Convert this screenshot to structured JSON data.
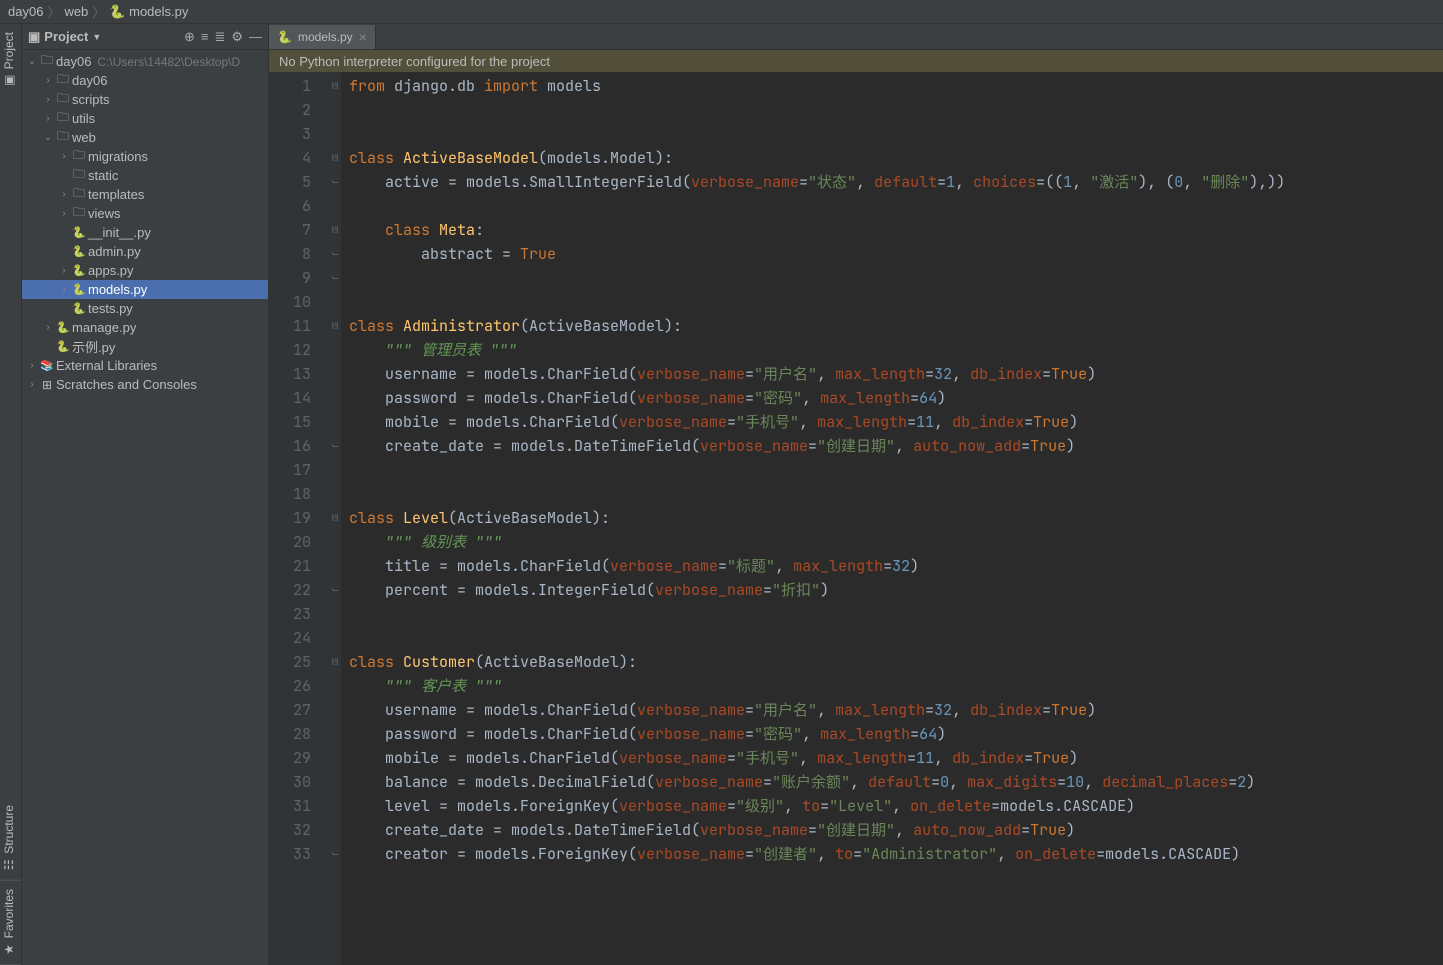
{
  "breadcrumb": [
    "day06",
    "web",
    "models.py"
  ],
  "project_label": "Project",
  "toolbar_icons": [
    "target-icon",
    "expand-icon",
    "collapse-icon",
    "gear-icon",
    "hide-icon"
  ],
  "tree": [
    {
      "depth": 0,
      "arrow": "v",
      "icon": "folder",
      "label": "day06",
      "path": "C:\\Users\\14482\\Desktop\\D",
      "selected": false
    },
    {
      "depth": 1,
      "arrow": ">",
      "icon": "pkg",
      "label": "day06"
    },
    {
      "depth": 1,
      "arrow": ">",
      "icon": "folder",
      "label": "scripts"
    },
    {
      "depth": 1,
      "arrow": ">",
      "icon": "folder",
      "label": "utils"
    },
    {
      "depth": 1,
      "arrow": "v",
      "icon": "pkg",
      "label": "web"
    },
    {
      "depth": 2,
      "arrow": ">",
      "icon": "pkg",
      "label": "migrations"
    },
    {
      "depth": 2,
      "arrow": "",
      "icon": "folder",
      "label": "static"
    },
    {
      "depth": 2,
      "arrow": ">",
      "icon": "folder",
      "label": "templates"
    },
    {
      "depth": 2,
      "arrow": ">",
      "icon": "pkg",
      "label": "views"
    },
    {
      "depth": 2,
      "arrow": "",
      "icon": "py",
      "label": "__init__.py"
    },
    {
      "depth": 2,
      "arrow": "",
      "icon": "py",
      "label": "admin.py"
    },
    {
      "depth": 2,
      "arrow": ">",
      "icon": "py",
      "label": "apps.py"
    },
    {
      "depth": 2,
      "arrow": ">",
      "icon": "py",
      "label": "models.py",
      "selected": true
    },
    {
      "depth": 2,
      "arrow": "",
      "icon": "py",
      "label": "tests.py"
    },
    {
      "depth": 1,
      "arrow": ">",
      "icon": "py",
      "label": "manage.py"
    },
    {
      "depth": 1,
      "arrow": "",
      "icon": "py",
      "label": "示例.py"
    },
    {
      "depth": 0,
      "arrow": ">",
      "icon": "lib",
      "label": "External Libraries"
    },
    {
      "depth": 0,
      "arrow": ">",
      "icon": "scratch",
      "label": "Scratches and Consoles"
    }
  ],
  "open_tab": "models.py",
  "warning": "No Python interpreter configured for the project",
  "sidebar_tabs": {
    "project": "Project",
    "structure": "Structure",
    "favorites": "Favorites"
  },
  "gutter": {
    "max_line": 33,
    "override_line": 4
  },
  "code_lines": [
    {
      "tokens": [
        [
          "kw",
          "from"
        ],
        [
          "",
          " django.db "
        ],
        [
          "kw",
          "import"
        ],
        [
          "",
          " models"
        ]
      ]
    },
    {
      "tokens": []
    },
    {
      "tokens": []
    },
    {
      "tokens": [
        [
          "kw",
          "class"
        ],
        [
          "",
          " "
        ],
        [
          "fn",
          "ActiveBaseModel"
        ],
        [
          "",
          "(models.Model):"
        ]
      ]
    },
    {
      "tokens": [
        [
          "",
          "    active = models.SmallIntegerField("
        ],
        [
          "param",
          "verbose_name"
        ],
        [
          "",
          "="
        ],
        [
          "str",
          "\"状态\""
        ],
        [
          "",
          ", "
        ],
        [
          "param",
          "default"
        ],
        [
          "",
          "="
        ],
        [
          "num",
          "1"
        ],
        [
          "",
          ", "
        ],
        [
          "param",
          "choices"
        ],
        [
          "",
          "=(("
        ],
        [
          "num",
          "1"
        ],
        [
          "",
          ", "
        ],
        [
          "str",
          "\"激活\""
        ],
        [
          "",
          "), ("
        ],
        [
          "num",
          "0"
        ],
        [
          "",
          ", "
        ],
        [
          "str",
          "\"删除\""
        ],
        [
          "",
          "),))"
        ]
      ]
    },
    {
      "tokens": []
    },
    {
      "tokens": [
        [
          "",
          "    "
        ],
        [
          "kw",
          "class"
        ],
        [
          "",
          " "
        ],
        [
          "fn",
          "Meta"
        ],
        [
          "",
          ":"
        ]
      ]
    },
    {
      "tokens": [
        [
          "",
          "        abstract = "
        ],
        [
          "kw",
          "True"
        ]
      ]
    },
    {
      "tokens": []
    },
    {
      "tokens": []
    },
    {
      "tokens": [
        [
          "kw",
          "class"
        ],
        [
          "",
          " "
        ],
        [
          "fn",
          "Administrator"
        ],
        [
          "",
          "(ActiveBaseModel):"
        ]
      ]
    },
    {
      "tokens": [
        [
          "doc",
          "    \"\"\" 管理员表 \"\"\""
        ]
      ]
    },
    {
      "tokens": [
        [
          "",
          "    username = models.CharField("
        ],
        [
          "param",
          "verbose_name"
        ],
        [
          "",
          "="
        ],
        [
          "str",
          "\"用户名\""
        ],
        [
          "",
          ", "
        ],
        [
          "param",
          "max_length"
        ],
        [
          "",
          "="
        ],
        [
          "num",
          "32"
        ],
        [
          "",
          ", "
        ],
        [
          "param",
          "db_index"
        ],
        [
          "",
          "="
        ],
        [
          "kw",
          "True"
        ],
        [
          "",
          ")"
        ]
      ]
    },
    {
      "tokens": [
        [
          "",
          "    password = models.CharField("
        ],
        [
          "param",
          "verbose_name"
        ],
        [
          "",
          "="
        ],
        [
          "str",
          "\"密码\""
        ],
        [
          "",
          ", "
        ],
        [
          "param",
          "max_length"
        ],
        [
          "",
          "="
        ],
        [
          "num",
          "64"
        ],
        [
          "",
          ")"
        ]
      ]
    },
    {
      "tokens": [
        [
          "",
          "    mobile = models.CharField("
        ],
        [
          "param",
          "verbose_name"
        ],
        [
          "",
          "="
        ],
        [
          "str",
          "\"手机号\""
        ],
        [
          "",
          ", "
        ],
        [
          "param",
          "max_length"
        ],
        [
          "",
          "="
        ],
        [
          "num",
          "11"
        ],
        [
          "",
          ", "
        ],
        [
          "param",
          "db_index"
        ],
        [
          "",
          "="
        ],
        [
          "kw",
          "True"
        ],
        [
          "",
          ")"
        ]
      ]
    },
    {
      "tokens": [
        [
          "",
          "    create_date = models.DateTimeField("
        ],
        [
          "param",
          "verbose_name"
        ],
        [
          "",
          "="
        ],
        [
          "str",
          "\"创建日期\""
        ],
        [
          "",
          ", "
        ],
        [
          "param",
          "auto_now_add"
        ],
        [
          "",
          "="
        ],
        [
          "kw",
          "True"
        ],
        [
          "",
          ")"
        ]
      ]
    },
    {
      "tokens": []
    },
    {
      "tokens": []
    },
    {
      "tokens": [
        [
          "kw",
          "class"
        ],
        [
          "",
          " "
        ],
        [
          "fn",
          "Level"
        ],
        [
          "",
          "(ActiveBaseModel):"
        ]
      ]
    },
    {
      "tokens": [
        [
          "doc",
          "    \"\"\" 级别表 \"\"\""
        ]
      ]
    },
    {
      "tokens": [
        [
          "",
          "    title = models.CharField("
        ],
        [
          "param",
          "verbose_name"
        ],
        [
          "",
          "="
        ],
        [
          "str",
          "\"标题\""
        ],
        [
          "",
          ", "
        ],
        [
          "param",
          "max_length"
        ],
        [
          "",
          "="
        ],
        [
          "num",
          "32"
        ],
        [
          "",
          ")"
        ]
      ]
    },
    {
      "tokens": [
        [
          "",
          "    percent = models.IntegerField("
        ],
        [
          "param",
          "verbose_name"
        ],
        [
          "",
          "="
        ],
        [
          "str",
          "\"折扣\""
        ],
        [
          "",
          ")"
        ]
      ]
    },
    {
      "tokens": []
    },
    {
      "tokens": []
    },
    {
      "tokens": [
        [
          "kw",
          "class"
        ],
        [
          "",
          " "
        ],
        [
          "fn",
          "Customer"
        ],
        [
          "",
          "(ActiveBaseModel):"
        ]
      ]
    },
    {
      "tokens": [
        [
          "doc",
          "    \"\"\" 客户表 \"\"\""
        ]
      ]
    },
    {
      "tokens": [
        [
          "",
          "    username = models.CharField("
        ],
        [
          "param",
          "verbose_name"
        ],
        [
          "",
          "="
        ],
        [
          "str",
          "\"用户名\""
        ],
        [
          "",
          ", "
        ],
        [
          "param",
          "max_length"
        ],
        [
          "",
          "="
        ],
        [
          "num",
          "32"
        ],
        [
          "",
          ", "
        ],
        [
          "param",
          "db_index"
        ],
        [
          "",
          "="
        ],
        [
          "kw",
          "True"
        ],
        [
          "",
          ")"
        ]
      ]
    },
    {
      "tokens": [
        [
          "",
          "    password = models.CharField("
        ],
        [
          "param",
          "verbose_name"
        ],
        [
          "",
          "="
        ],
        [
          "str",
          "\"密码\""
        ],
        [
          "",
          ", "
        ],
        [
          "param",
          "max_length"
        ],
        [
          "",
          "="
        ],
        [
          "num",
          "64"
        ],
        [
          "",
          ")"
        ]
      ]
    },
    {
      "tokens": [
        [
          "",
          "    mobile = models.CharField("
        ],
        [
          "param",
          "verbose_name"
        ],
        [
          "",
          "="
        ],
        [
          "str",
          "\"手机号\""
        ],
        [
          "",
          ", "
        ],
        [
          "param",
          "max_length"
        ],
        [
          "",
          "="
        ],
        [
          "num",
          "11"
        ],
        [
          "",
          ", "
        ],
        [
          "param",
          "db_index"
        ],
        [
          "",
          "="
        ],
        [
          "kw",
          "True"
        ],
        [
          "",
          ")"
        ]
      ]
    },
    {
      "tokens": [
        [
          "",
          "    balance = models.DecimalField("
        ],
        [
          "param",
          "verbose_name"
        ],
        [
          "",
          "="
        ],
        [
          "str",
          "\"账户余额\""
        ],
        [
          "",
          ", "
        ],
        [
          "param",
          "default"
        ],
        [
          "",
          "="
        ],
        [
          "num",
          "0"
        ],
        [
          "",
          ", "
        ],
        [
          "param",
          "max_digits"
        ],
        [
          "",
          "="
        ],
        [
          "num",
          "10"
        ],
        [
          "",
          ", "
        ],
        [
          "param",
          "decimal_places"
        ],
        [
          "",
          "="
        ],
        [
          "num",
          "2"
        ],
        [
          "",
          ")"
        ]
      ]
    },
    {
      "tokens": [
        [
          "",
          "    level = models.ForeignKey("
        ],
        [
          "param",
          "verbose_name"
        ],
        [
          "",
          "="
        ],
        [
          "str",
          "\"级别\""
        ],
        [
          "",
          ", "
        ],
        [
          "param",
          "to"
        ],
        [
          "",
          "="
        ],
        [
          "str",
          "\"Level\""
        ],
        [
          "",
          ", "
        ],
        [
          "param",
          "on_delete"
        ],
        [
          "",
          "=models.CASCADE)"
        ]
      ]
    },
    {
      "tokens": [
        [
          "",
          "    create_date = models.DateTimeField("
        ],
        [
          "param",
          "verbose_name"
        ],
        [
          "",
          "="
        ],
        [
          "str",
          "\"创建日期\""
        ],
        [
          "",
          ", "
        ],
        [
          "param",
          "auto_now_add"
        ],
        [
          "",
          "="
        ],
        [
          "kw",
          "True"
        ],
        [
          "",
          ")"
        ]
      ]
    },
    {
      "tokens": [
        [
          "",
          "    creator = models.ForeignKey("
        ],
        [
          "param",
          "verbose_name"
        ],
        [
          "",
          "="
        ],
        [
          "str",
          "\"创建者\""
        ],
        [
          "",
          ", "
        ],
        [
          "param",
          "to"
        ],
        [
          "",
          "="
        ],
        [
          "str",
          "\"Administrator\""
        ],
        [
          "",
          ", "
        ],
        [
          "param",
          "on_delete"
        ],
        [
          "",
          "=models.CASCADE)"
        ]
      ]
    }
  ]
}
